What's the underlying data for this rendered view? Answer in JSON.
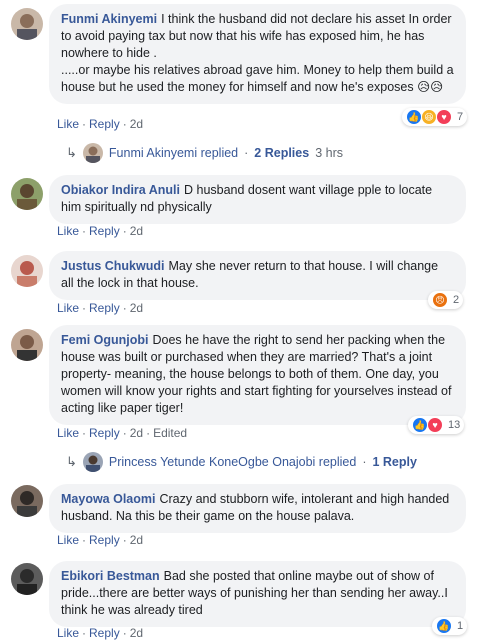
{
  "comments": [
    {
      "author": "Funmi Akinyemi",
      "text": "I think the husband did not declare his asset In order to avoid paying tax but now that his wife has exposed him, he has nowhere to hide .\n.....or maybe his relatives abroad gave him. Money to help them build a house but he used the money for himself and now he's exposes",
      "emoji": "😥😥",
      "like": "Like",
      "reply": "Reply",
      "time": "2d",
      "reaction_count": "7",
      "reactions": [
        "like",
        "haha",
        "love"
      ],
      "colors": {
        "avatar": "#8a6e5a"
      }
    },
    {
      "author": "Obiakor Indira Anuli",
      "text": "D husband dosent want village pple to locate him spiritually nd physically",
      "like": "Like",
      "reply": "Reply",
      "time": "2d",
      "colors": {
        "avatar": "#5a6b3a"
      }
    },
    {
      "author": "Justus Chukwudi",
      "text": "May she never return to that house. I will change all the lock in that house.",
      "like": "Like",
      "reply": "Reply",
      "time": "2d",
      "reaction_count": "2",
      "reactions": [
        "angry"
      ],
      "colors": {
        "avatar": "#b95a4d"
      }
    },
    {
      "author": "Femi Ogunjobi",
      "text": "Does he have the right to send her packing when the house was built or purchased when they are married? That's a joint property- meaning, the house belongs to both of them. One day, you women will know your rights and start fighting for yourselves instead of acting like paper tiger!",
      "like": "Like",
      "reply": "Reply",
      "time": "2d",
      "edited": "Edited",
      "reaction_count": "13",
      "reactions": [
        "like",
        "love"
      ],
      "colors": {
        "avatar": "#7b5b48"
      }
    },
    {
      "author": "Mayowa Olaomi",
      "text": "Crazy and stubborn wife, intolerant and high handed husband. Na this be their game on the house palava.",
      "like": "Like",
      "reply": "Reply",
      "time": "2d",
      "colors": {
        "avatar": "#3b3b3b"
      }
    },
    {
      "author": "Ebikori Bestman",
      "text": "Bad she posted that online maybe out of show of pride...there are better ways of punishing her than sending her away..I think he was already tired",
      "like": "Like",
      "reply": "Reply",
      "time": "2d",
      "reaction_count": "1",
      "reactions": [
        "like"
      ],
      "colors": {
        "avatar": "#2b2b2b"
      }
    }
  ],
  "replies": [
    {
      "name": "Funmi Akinyemi replied",
      "separator": "·",
      "count": "2 Replies",
      "time": "3 hrs"
    },
    {
      "name": "Princess Yetunde KoneOgbe Onajobi replied",
      "separator": "·",
      "count": "1 Reply"
    }
  ]
}
